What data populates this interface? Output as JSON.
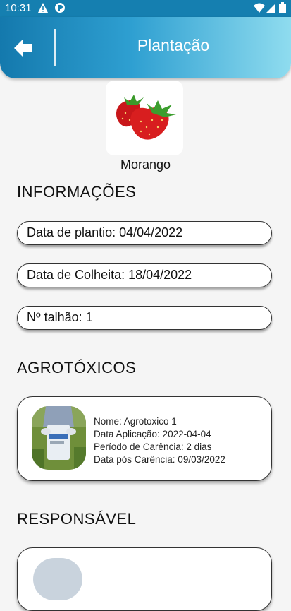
{
  "status_bar": {
    "time": "10:31"
  },
  "app_bar": {
    "title": "Plantação"
  },
  "crop": {
    "name": "Morango"
  },
  "sections": {
    "info_title": "INFORMAÇÕES",
    "pesticides_title": "AGROTÓXICOS",
    "responsible_title": "RESPONSÁVEL"
  },
  "info": {
    "planting_date": "Data de plantio: 04/04/2022",
    "harvest_date": "Data de Colheita: 18/04/2022",
    "plot_number": "Nº talhão: 1"
  },
  "pesticide": {
    "name": "Nome: Agrotoxico 1",
    "application_date": "Data Aplicação: 2022-04-04",
    "grace_period": "Período de Carência: 2 dias",
    "after_grace_date": "Data pós Carência: 09/03/2022"
  }
}
